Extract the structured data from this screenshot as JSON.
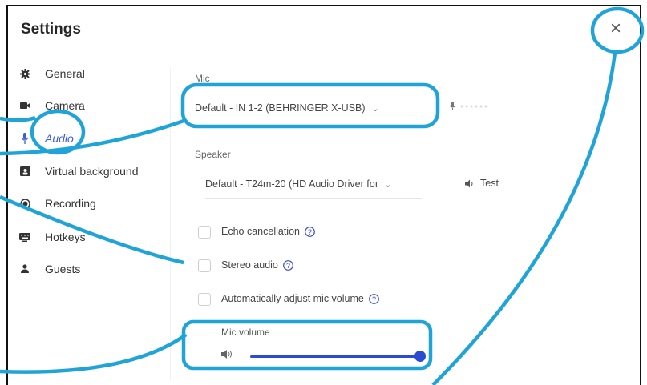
{
  "dialog": {
    "title": "Settings"
  },
  "sidebar": {
    "items": [
      {
        "label": "General",
        "icon": "gear-icon"
      },
      {
        "label": "Camera",
        "icon": "camera-icon"
      },
      {
        "label": "Audio",
        "icon": "mic-icon",
        "active": true
      },
      {
        "label": "Virtual background",
        "icon": "background-icon"
      },
      {
        "label": "Recording",
        "icon": "record-icon"
      },
      {
        "label": "Hotkeys",
        "icon": "keyboard-icon"
      },
      {
        "label": "Guests",
        "icon": "person-icon"
      }
    ]
  },
  "audio": {
    "mic_label": "Mic",
    "mic_value": "Default - IN 1-2 (BEHRINGER X-USB)",
    "speaker_label": "Speaker",
    "speaker_value": "Default - T24m-20 (HD Audio Driver foı",
    "test_label": "Test",
    "echo_label": "Echo cancellation",
    "stereo_label": "Stereo audio",
    "auto_label": "Automatically adjust mic volume",
    "mic_volume_label": "Mic volume",
    "mic_volume": 1.0
  },
  "colors": {
    "accent": "#2b4bd1",
    "highlight": "#20a4d8"
  }
}
